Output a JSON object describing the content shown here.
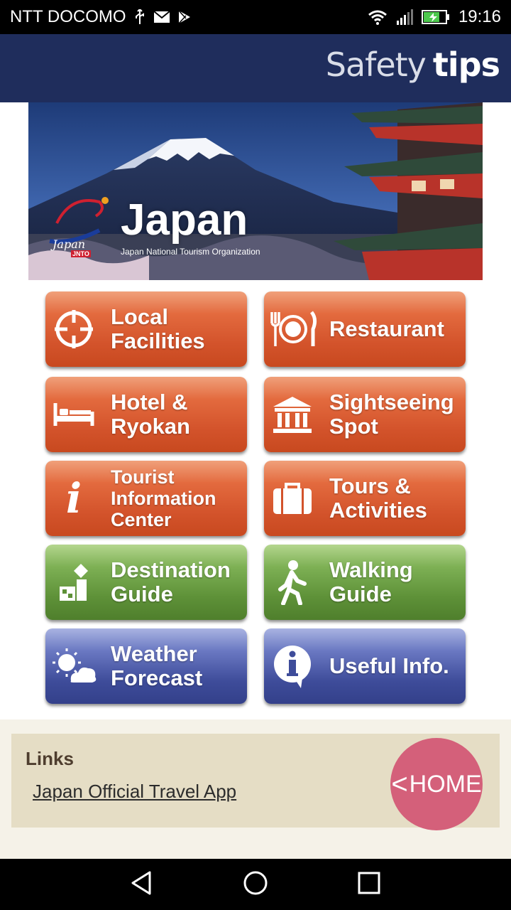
{
  "status_bar": {
    "carrier": "NTT DOCOMO",
    "time": "19:16"
  },
  "header": {
    "title_light": "Safety",
    "title_bold": "tips"
  },
  "banner": {
    "logo_text": "Japan",
    "logo_sub": "JNTO",
    "title": "Japan",
    "subtitle": "Japan National Tourism Organization"
  },
  "menu": [
    {
      "label": "Local\nFacilities",
      "icon": "crosshair-icon",
      "color": "#d3532b"
    },
    {
      "label": "Restaurant",
      "icon": "plate-cutlery-icon",
      "color": "#d3532b"
    },
    {
      "label": "Hotel &\nRyokan",
      "icon": "bed-icon",
      "color": "#d3532b"
    },
    {
      "label": "Sightseeing\nSpot",
      "icon": "temple-icon",
      "color": "#d3532b"
    },
    {
      "label": "Tourist\nInformation\nCenter",
      "icon": "info-i-icon",
      "color": "#d3532b"
    },
    {
      "label": "Tours &\nActivities",
      "icon": "suitcase-icon",
      "color": "#d3532b"
    },
    {
      "label": "Destination\nGuide",
      "icon": "destination-icon",
      "color": "#5e9138"
    },
    {
      "label": "Walking\nGuide",
      "icon": "walking-person-icon",
      "color": "#5e9138"
    },
    {
      "label": "Weather\nForecast",
      "icon": "sun-cloud-icon",
      "color": "#3e4c9a"
    },
    {
      "label": "Useful Info.",
      "icon": "info-bubble-icon",
      "color": "#3e4c9a"
    }
  ],
  "links": {
    "title": "Links",
    "items": [
      "Japan Official Travel App"
    ]
  },
  "home_button": {
    "chevron": "<",
    "label": "HOME"
  }
}
